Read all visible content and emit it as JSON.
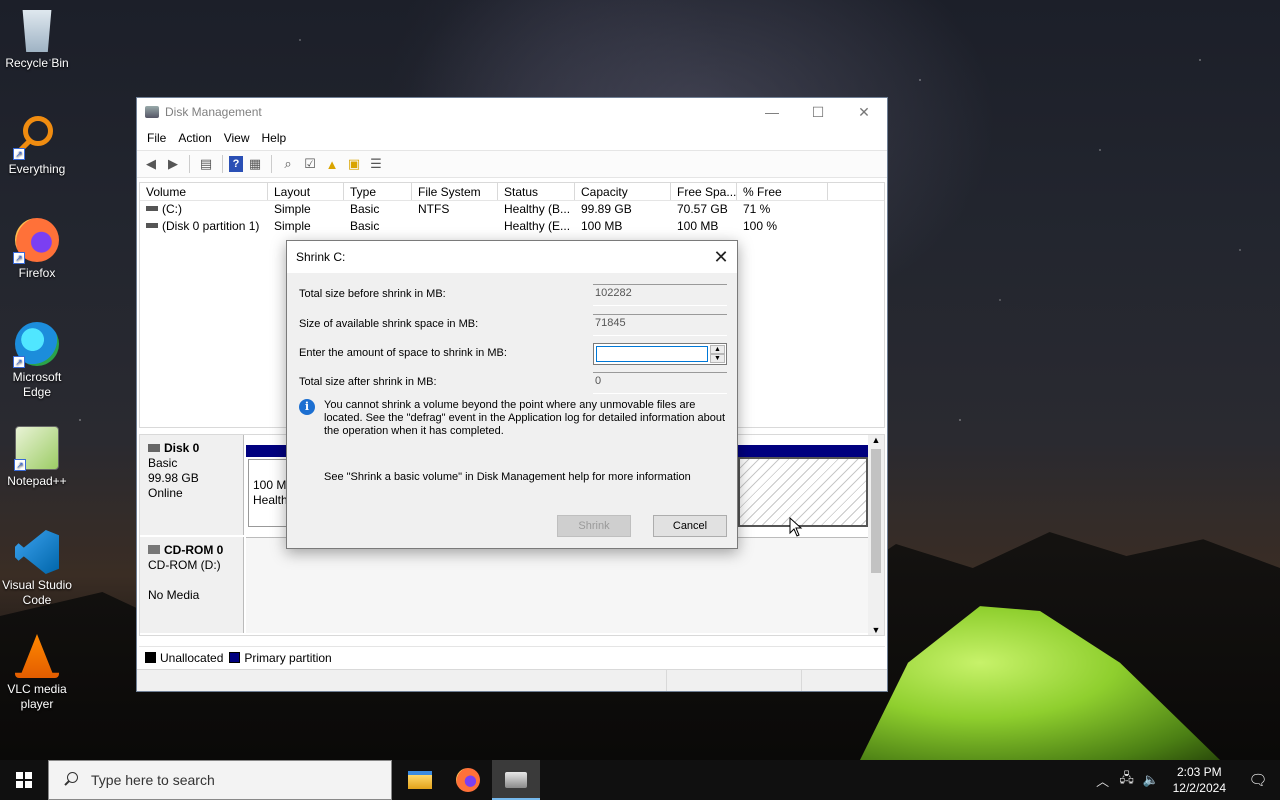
{
  "desktop": {
    "icons": [
      {
        "label": "Recycle Bin"
      },
      {
        "label": "Everything"
      },
      {
        "label": "Firefox"
      },
      {
        "label": "Microsoft Edge"
      },
      {
        "label": "Notepad++"
      },
      {
        "label": "Visual Studio Code"
      },
      {
        "label": "VLC media player"
      }
    ]
  },
  "window": {
    "title": "Disk Management",
    "menu": [
      "File",
      "Action",
      "View",
      "Help"
    ],
    "volume_table": {
      "columns": [
        "Volume",
        "Layout",
        "Type",
        "File System",
        "Status",
        "Capacity",
        "Free Spa...",
        "% Free"
      ],
      "rows": [
        {
          "volume": "(C:)",
          "layout": "Simple",
          "type": "Basic",
          "fs": "NTFS",
          "status": "Healthy (B...",
          "capacity": "99.89 GB",
          "free": "70.57 GB",
          "pct": "71 %"
        },
        {
          "volume": "(Disk 0 partition 1)",
          "layout": "Simple",
          "type": "Basic",
          "fs": "",
          "status": "Healthy (E...",
          "capacity": "100 MB",
          "free": "100 MB",
          "pct": "100 %"
        }
      ]
    },
    "disks": {
      "disk0": {
        "name": "Disk 0",
        "type": "Basic",
        "size": "99.98 GB",
        "state": "Online",
        "part1_size": "100 MB",
        "part1_status": "Healthy"
      },
      "cdrom0": {
        "name": "CD-ROM 0",
        "type": "CD-ROM (D:)",
        "state": "No Media"
      }
    },
    "legend": {
      "unallocated": "Unallocated",
      "primary": "Primary partition"
    },
    "colors": {
      "primary": "#00007f",
      "unallocated": "#000000"
    }
  },
  "dialog": {
    "title": "Shrink C:",
    "fields": {
      "total_before_label": "Total size before shrink in MB:",
      "total_before_value": "102282",
      "available_label": "Size of available shrink space in MB:",
      "available_value": "71845",
      "amount_label": "Enter the amount of space to shrink in MB:",
      "amount_value": "",
      "total_after_label": "Total size after shrink in MB:",
      "total_after_value": "0"
    },
    "info": "You cannot shrink a volume beyond the point where any unmovable files are located. See the \"defrag\" event in the Application log for detailed information about the operation when it has completed.",
    "help": "See \"Shrink a basic volume\" in Disk Management help for more information",
    "shrink_label": "Shrink",
    "cancel_label": "Cancel"
  },
  "taskbar": {
    "search_placeholder": "Type here to search",
    "time": "2:03 PM",
    "date": "12/2/2024"
  }
}
